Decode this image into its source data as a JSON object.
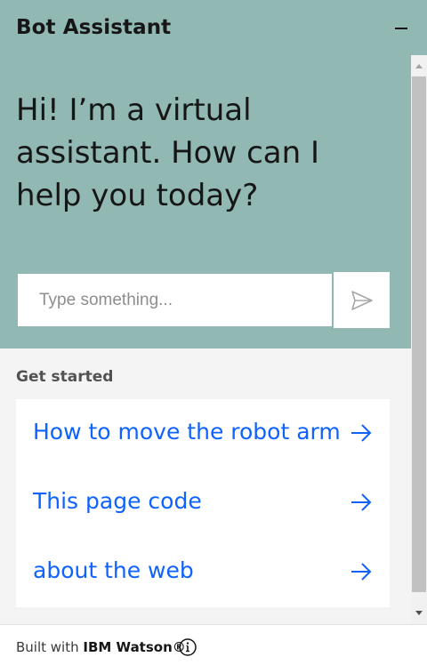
{
  "header": {
    "title": "Bot Assistant",
    "minimize_icon": "minimize-icon"
  },
  "hero": {
    "greeting": "Hi! I’m a virtual assistant. How can I help you today?",
    "input_placeholder": "Type something...",
    "input_value": "",
    "send_icon": "send-icon"
  },
  "get_started": {
    "heading": "Get started",
    "items": [
      {
        "label": "How to move the robot arm",
        "icon": "arrow-right-icon"
      },
      {
        "label": "This page code",
        "icon": "arrow-right-icon"
      },
      {
        "label": "about the web",
        "icon": "arrow-right-icon"
      }
    ]
  },
  "footer": {
    "built_with": "Built with",
    "brand": "IBM Watson®",
    "info_icon": "information-icon"
  },
  "colors": {
    "header_bg": "#91b8b3",
    "accent_link": "#0f62fe",
    "panel_bg": "#f4f4f4"
  }
}
